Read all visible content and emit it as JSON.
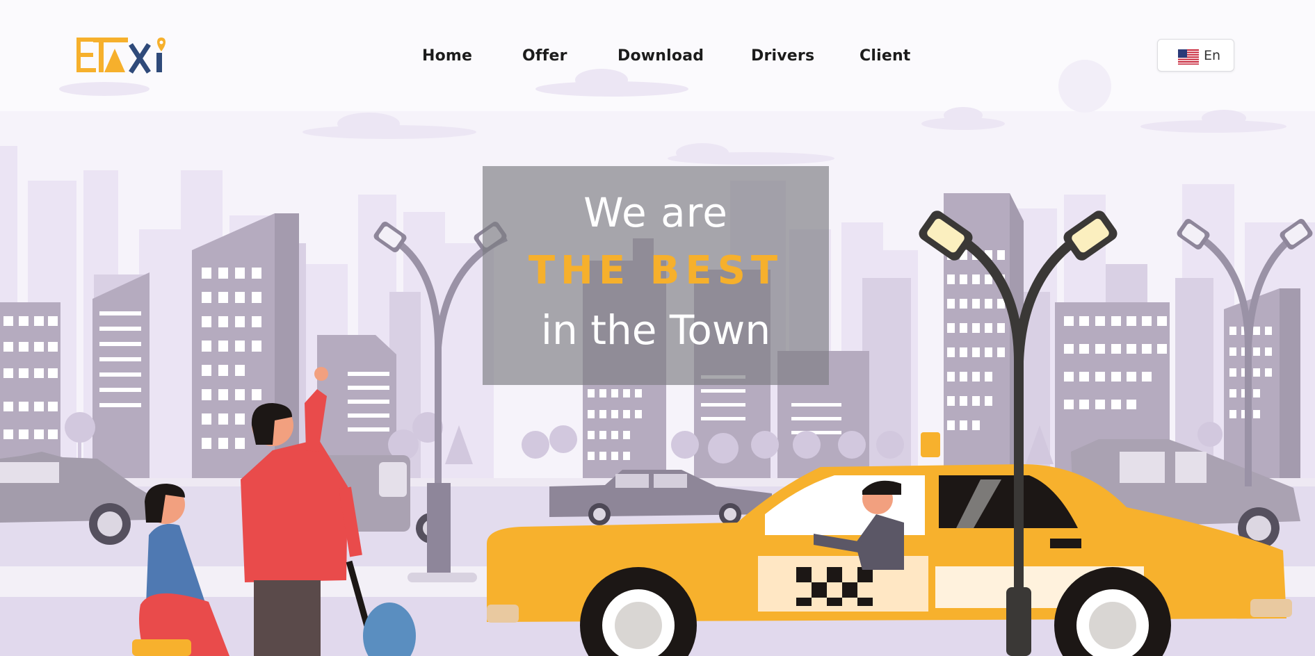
{
  "brand": {
    "name": "ETAXi",
    "logo_letters": [
      "E",
      "T",
      "A",
      "X",
      "i"
    ]
  },
  "nav": {
    "items": [
      {
        "label": "Home"
      },
      {
        "label": "Offer"
      },
      {
        "label": "Download"
      },
      {
        "label": "Drivers"
      },
      {
        "label": "Client"
      }
    ]
  },
  "language": {
    "label": "En",
    "flag_icon": "us-flag-icon"
  },
  "hero": {
    "line1": "We are",
    "line2": "THE BEST",
    "line3": "in the Town"
  },
  "colors": {
    "accent": "#f6b02c",
    "logo_dark": "#2f4a7a",
    "nav_text": "#1c1c1c",
    "city_light": "#e9e2f3",
    "city_mid": "#bdb3c9",
    "city_dark": "#a49bae",
    "taxi_yellow": "#f7b12d"
  }
}
